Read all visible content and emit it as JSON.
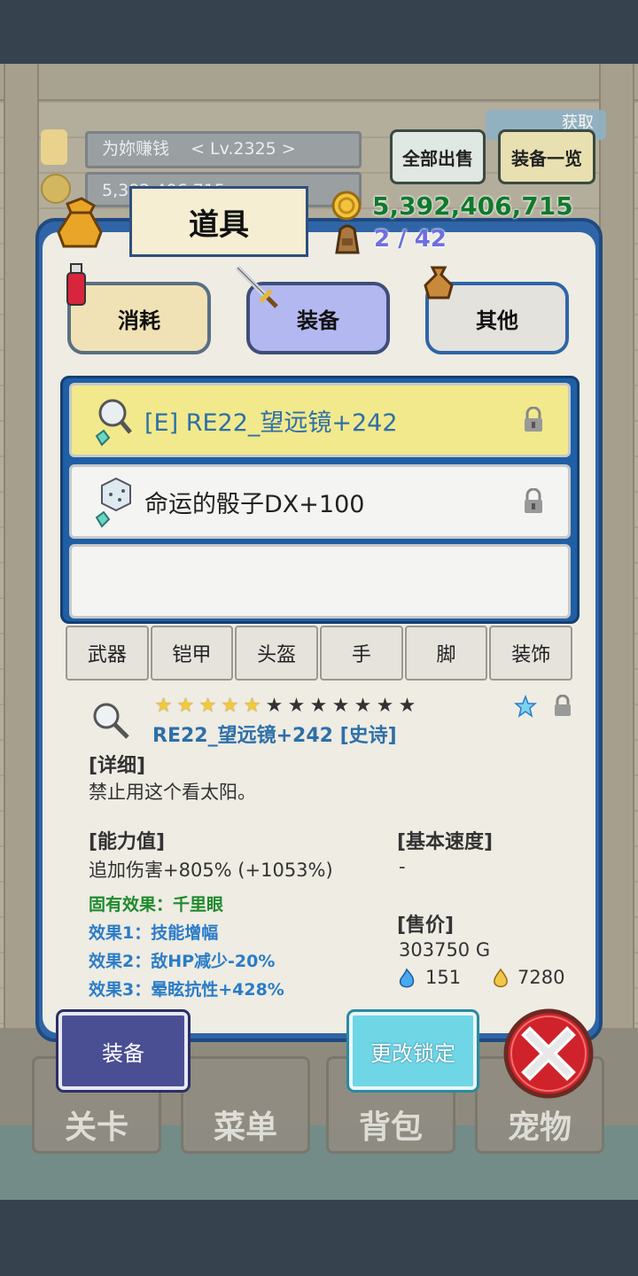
{
  "background": {
    "player_name": "为妳赚钱",
    "player_level": "< Lv.2325 >",
    "gold_partial": "5,392,406,715",
    "acquire_label": "获取",
    "sell_all_label": "全部出售",
    "equip_list_label": "装备一览",
    "nav": [
      "关卡",
      "菜单",
      "背包",
      "宠物"
    ]
  },
  "header": {
    "title": "道具",
    "gold": "5,392,406,715",
    "capacity": "2 / 42"
  },
  "categories": [
    {
      "label": "消耗",
      "selected": false
    },
    {
      "label": "装备",
      "selected": true
    },
    {
      "label": "其他",
      "selected": false
    }
  ],
  "items": [
    {
      "label": "[E] RE22_望远镜+242",
      "selected": true,
      "icon": "magnifier-icon"
    },
    {
      "label": "命运的骰子DX+100",
      "selected": false,
      "icon": "dice-icon"
    },
    {
      "label": "",
      "selected": false,
      "icon": ""
    }
  ],
  "filter_tabs": [
    "武器",
    "铠甲",
    "头盔",
    "手",
    "脚",
    "装饰"
  ],
  "detail": {
    "stars_filled": 5,
    "stars_total": 12,
    "name": "RE22_望远镜+242 [史诗]",
    "detail_heading": "[详细]",
    "description": "禁止用这个看太阳。",
    "ability_heading": "[能力值]",
    "ability_value": "追加伤害+805% (+1053%)",
    "speed_heading": "[基本速度]",
    "speed_value": "-",
    "inherent_effect": "固有效果：千里眼",
    "effect1": "效果1：技能增幅",
    "effect2": "效果2：敌HP减少-20%",
    "effect3": "效果3：晕眩抗性+428%",
    "price_heading": "[售价]",
    "price": "303750 G",
    "blue_flame": "151",
    "gold_drop": "7280"
  },
  "actions": {
    "equip": "装备",
    "change_lock": "更改锁定"
  },
  "colors": {
    "panel_blue": "#2f65a6",
    "selected_row": "#f2e98c",
    "item_name": "#2e6fa8",
    "inherent_effect": "#1e8a2e",
    "effect": "#2a7cc8",
    "gold_text": "#0f7a2c",
    "capacity_text": "#6f6ee0"
  }
}
